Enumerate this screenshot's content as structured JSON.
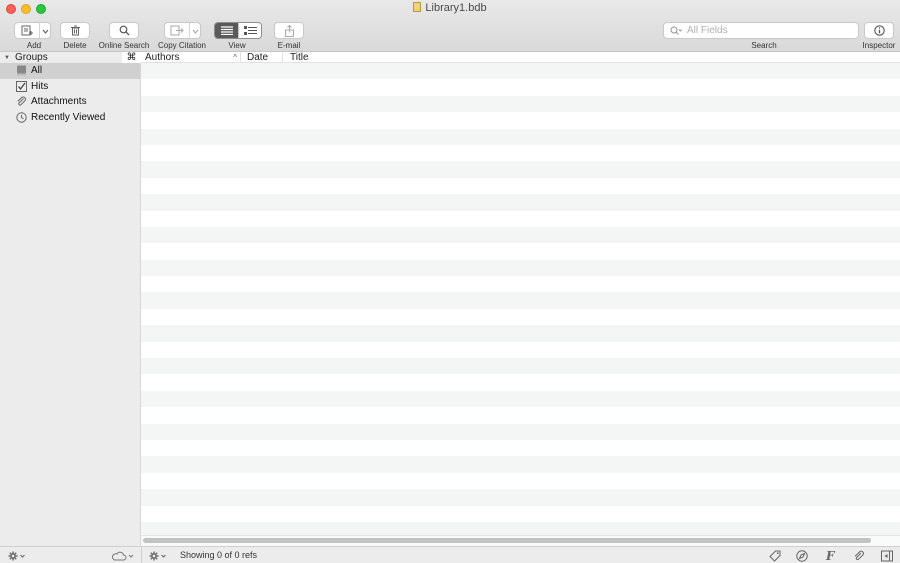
{
  "window": {
    "title": "Library1.bdb"
  },
  "toolbar": {
    "add_label": "Add",
    "delete_label": "Delete",
    "online_search_label": "Online Search",
    "copy_citation_label": "Copy Citation",
    "view_label": "View",
    "email_label": "E-mail",
    "search_label": "Search",
    "inspector_label": "Inspector",
    "search_placeholder": "All Fields",
    "view_mode": "list"
  },
  "sidebar": {
    "header": "Groups",
    "items": [
      {
        "label": "All",
        "icon": "library-icon",
        "selected": true
      },
      {
        "label": "Hits",
        "icon": "checkbox-icon",
        "selected": false
      },
      {
        "label": "Attachments",
        "icon": "paperclip-icon",
        "selected": false
      },
      {
        "label": "Recently Viewed",
        "icon": "clock-icon",
        "selected": false
      }
    ]
  },
  "table": {
    "command_symbol": "⌘",
    "columns": [
      {
        "label": "Authors",
        "sorted": "ascending"
      },
      {
        "label": "Date"
      },
      {
        "label": "Title"
      }
    ],
    "rows": []
  },
  "status": {
    "text": "Showing 0 of 0 refs"
  },
  "colors": {
    "selected_row": "#d0d0d0",
    "stripe": "#f4f5f5",
    "close": "#fe5f57",
    "minimize": "#febc2e",
    "maximize": "#28c840"
  }
}
